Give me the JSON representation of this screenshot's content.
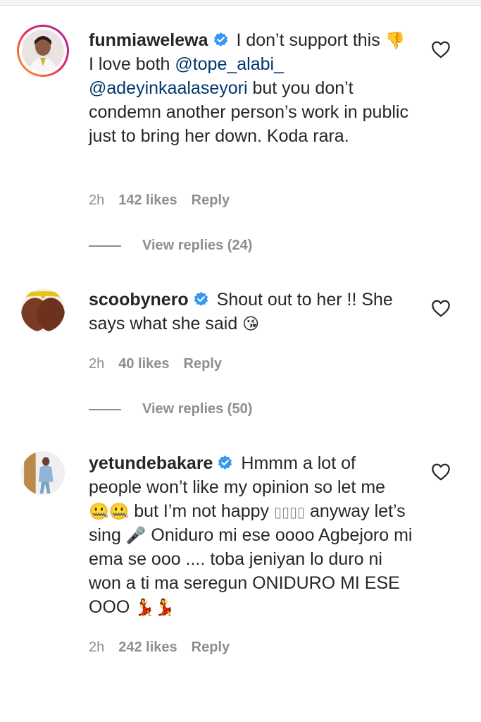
{
  "comments": [
    {
      "username": "funmiawelewa",
      "text_a": " I don’t support this ",
      "emoji_a": "👎",
      "text_b": " I love both ",
      "mention1": "@tope_alabi_",
      "mention2": "@adeyinkaalaseyori",
      "text_c": " but you don’t condemn another person’s work in public just to bring her down. Koda rara.",
      "time": "2h",
      "likes": "142 likes",
      "reply": "Reply",
      "view_replies": "View replies (24)"
    },
    {
      "username": "scoobynero",
      "text_a": " Shout out to her !! She says what she said ",
      "emoji_a": "😘",
      "time": "2h",
      "likes": "40 likes",
      "reply": "Reply",
      "view_replies": "View replies (50)"
    },
    {
      "username": "yetundebakare",
      "text_a": " Hmmm a lot of people won’t like my opinion so let me ",
      "emoji_a": "🤐🤐",
      "text_b": " but I’m not happy ",
      "emoji_b": "▯▯▯▯",
      "text_c": " anyway let’s sing ",
      "emoji_c": "🎤",
      "text_d": " Oniduro mi ese oooo Agbejoro mi ema se ooo .... toba jeniyan lo duro ni won a ti ma seregun ONIDURO MI ESE OOO ",
      "emoji_d": "💃💃",
      "time": "2h",
      "likes": "242 likes",
      "reply": "Reply"
    }
  ],
  "colors": {
    "verified_badge": "#3897f0",
    "mention": "#00376b",
    "muted": "#8e8e8e",
    "text": "#262626"
  },
  "icons": [
    "verified-badge-icon",
    "heart-outline-icon"
  ]
}
